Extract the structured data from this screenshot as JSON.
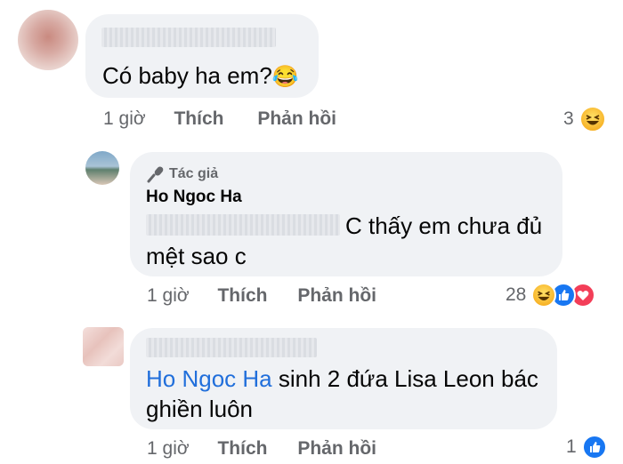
{
  "comments": [
    {
      "text": "Có baby ha em?",
      "emoji": "😂",
      "time": "1 giờ",
      "like_label": "Thích",
      "reply_label": "Phản hồi",
      "reaction_count": "3"
    },
    {
      "author_badge": "Tác giả",
      "author_name": "Ho Ngoc Ha",
      "text_line1": "C thấy em chưa đủ",
      "text_line2": "mệt sao c",
      "time": "1 giờ",
      "like_label": "Thích",
      "reply_label": "Phản hồi",
      "reaction_count": "28"
    },
    {
      "mention": "Ho Ngoc Ha",
      "text_line1": " sinh 2 đứa Lisa Leon bác",
      "text_line2": "ghiền luôn",
      "time": "1 giờ",
      "like_label": "Thích",
      "reply_label": "Phản hồi",
      "reaction_count": "1"
    }
  ],
  "colors": {
    "bubble": "#f0f2f5",
    "meta_text": "#65676b",
    "mention": "#216fdb",
    "like": "#1877f2",
    "love": "#f33e58",
    "haha": "#f7b125"
  }
}
